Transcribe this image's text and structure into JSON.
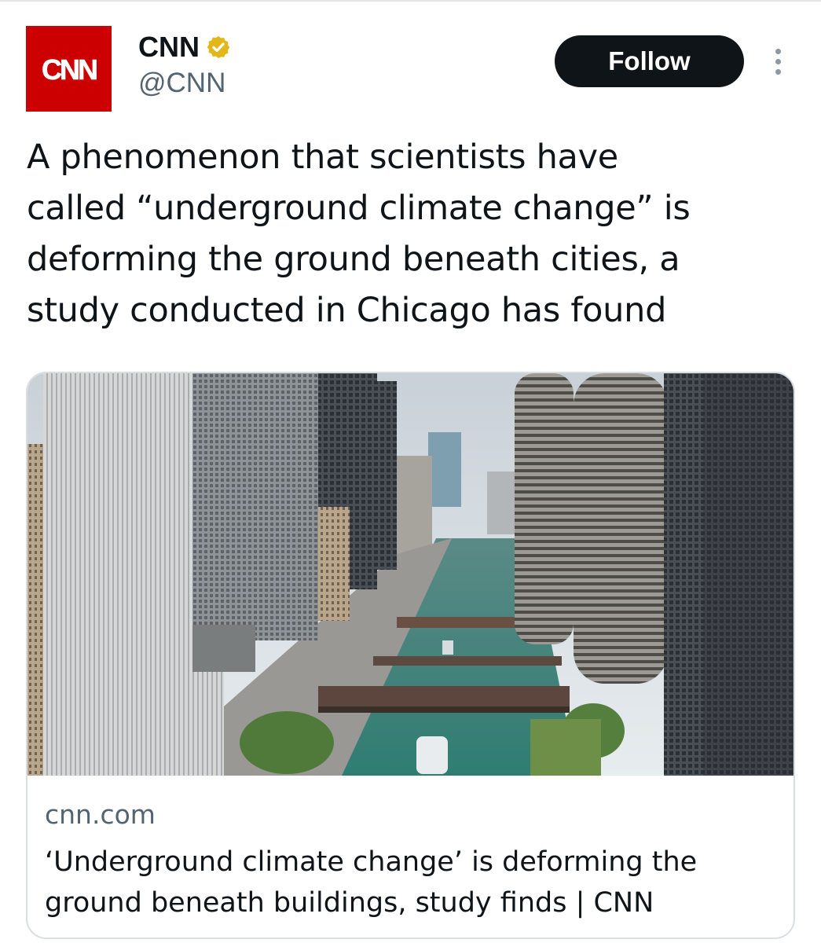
{
  "tweet": {
    "author": {
      "display_name": "CNN",
      "handle": "@CNN",
      "avatar_text": "CNN",
      "verified_icon": "verified-gold-badge-icon"
    },
    "follow_label": "Follow",
    "more_icon": "vertical-ellipsis-icon",
    "text_lines": [
      "A phenomenon that scientists have",
      "called “underground climate change” is",
      "deforming the ground beneath cities, a",
      "study conducted in Chicago has found"
    ]
  },
  "link_card": {
    "image_subject": "chicago-river-skyline-photo",
    "domain": "cnn.com",
    "title_lines": [
      "‘Underground climate change’ is deforming the",
      "ground beneath buildings, study finds | CNN"
    ]
  },
  "colors": {
    "brand_red": "#cc0000",
    "text_primary": "#0f1419",
    "text_secondary": "#536471",
    "verified_gold": "#e2b719",
    "button_bg": "#0f1419",
    "border": "#d9dee3"
  }
}
